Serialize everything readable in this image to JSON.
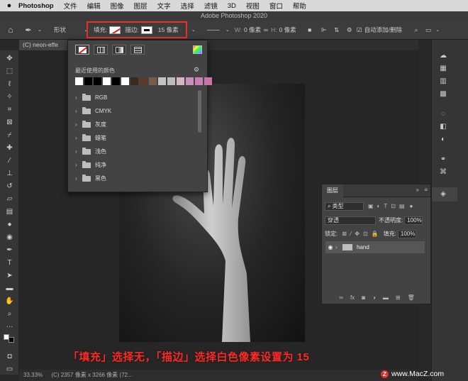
{
  "menubar": {
    "apple": "",
    "app_name": "Photoshop",
    "items": [
      "文件",
      "编辑",
      "图像",
      "图层",
      "文字",
      "选择",
      "滤镜",
      "3D",
      "视图",
      "窗口",
      "帮助"
    ]
  },
  "window": {
    "title": "Adobe Photoshop 2020"
  },
  "options": {
    "mode": "形状",
    "fill_label": "填充:",
    "stroke_label": "描边:",
    "stroke_width": "15 像素",
    "w_label": "W:",
    "w_value": "0 像素",
    "h_label": "H:",
    "h_value": "0 像素",
    "auto_add_delete": "自动添加/删除"
  },
  "document": {
    "tab": "(C) neon-effe",
    "zoom": "33.33%",
    "info": "(C) 2357 像素 x 3266 像素 (72..."
  },
  "color_panel": {
    "recent_label": "最近使用的颜色",
    "recent_swatches": [
      "#ffffff",
      "#000000",
      "#000000",
      "#ffffff",
      "#000000",
      "#ffffff",
      "#3a2a20",
      "#5a3a2a",
      "#7a5a48",
      "#c4c4c4",
      "#bdbdbd",
      "#d4b6c8",
      "#c890b8",
      "#c97fb0",
      "#c874a8"
    ],
    "groups": [
      "RGB",
      "CMYK",
      "灰度",
      "蜡笔",
      "浅色",
      "纯净",
      "黑色"
    ]
  },
  "layers": {
    "tab": "图层",
    "filter_type": "类型",
    "blend_mode": "穿透",
    "opacity_label": "不透明度:",
    "opacity_value": "100%",
    "lock_label": "锁定:",
    "fill_label": "填充:",
    "fill_value": "100%",
    "layer_name": "hand"
  },
  "caption": "「填充」选择无，「描边」选择白色像素设置为 15",
  "watermark": "www.MacZ.com"
}
